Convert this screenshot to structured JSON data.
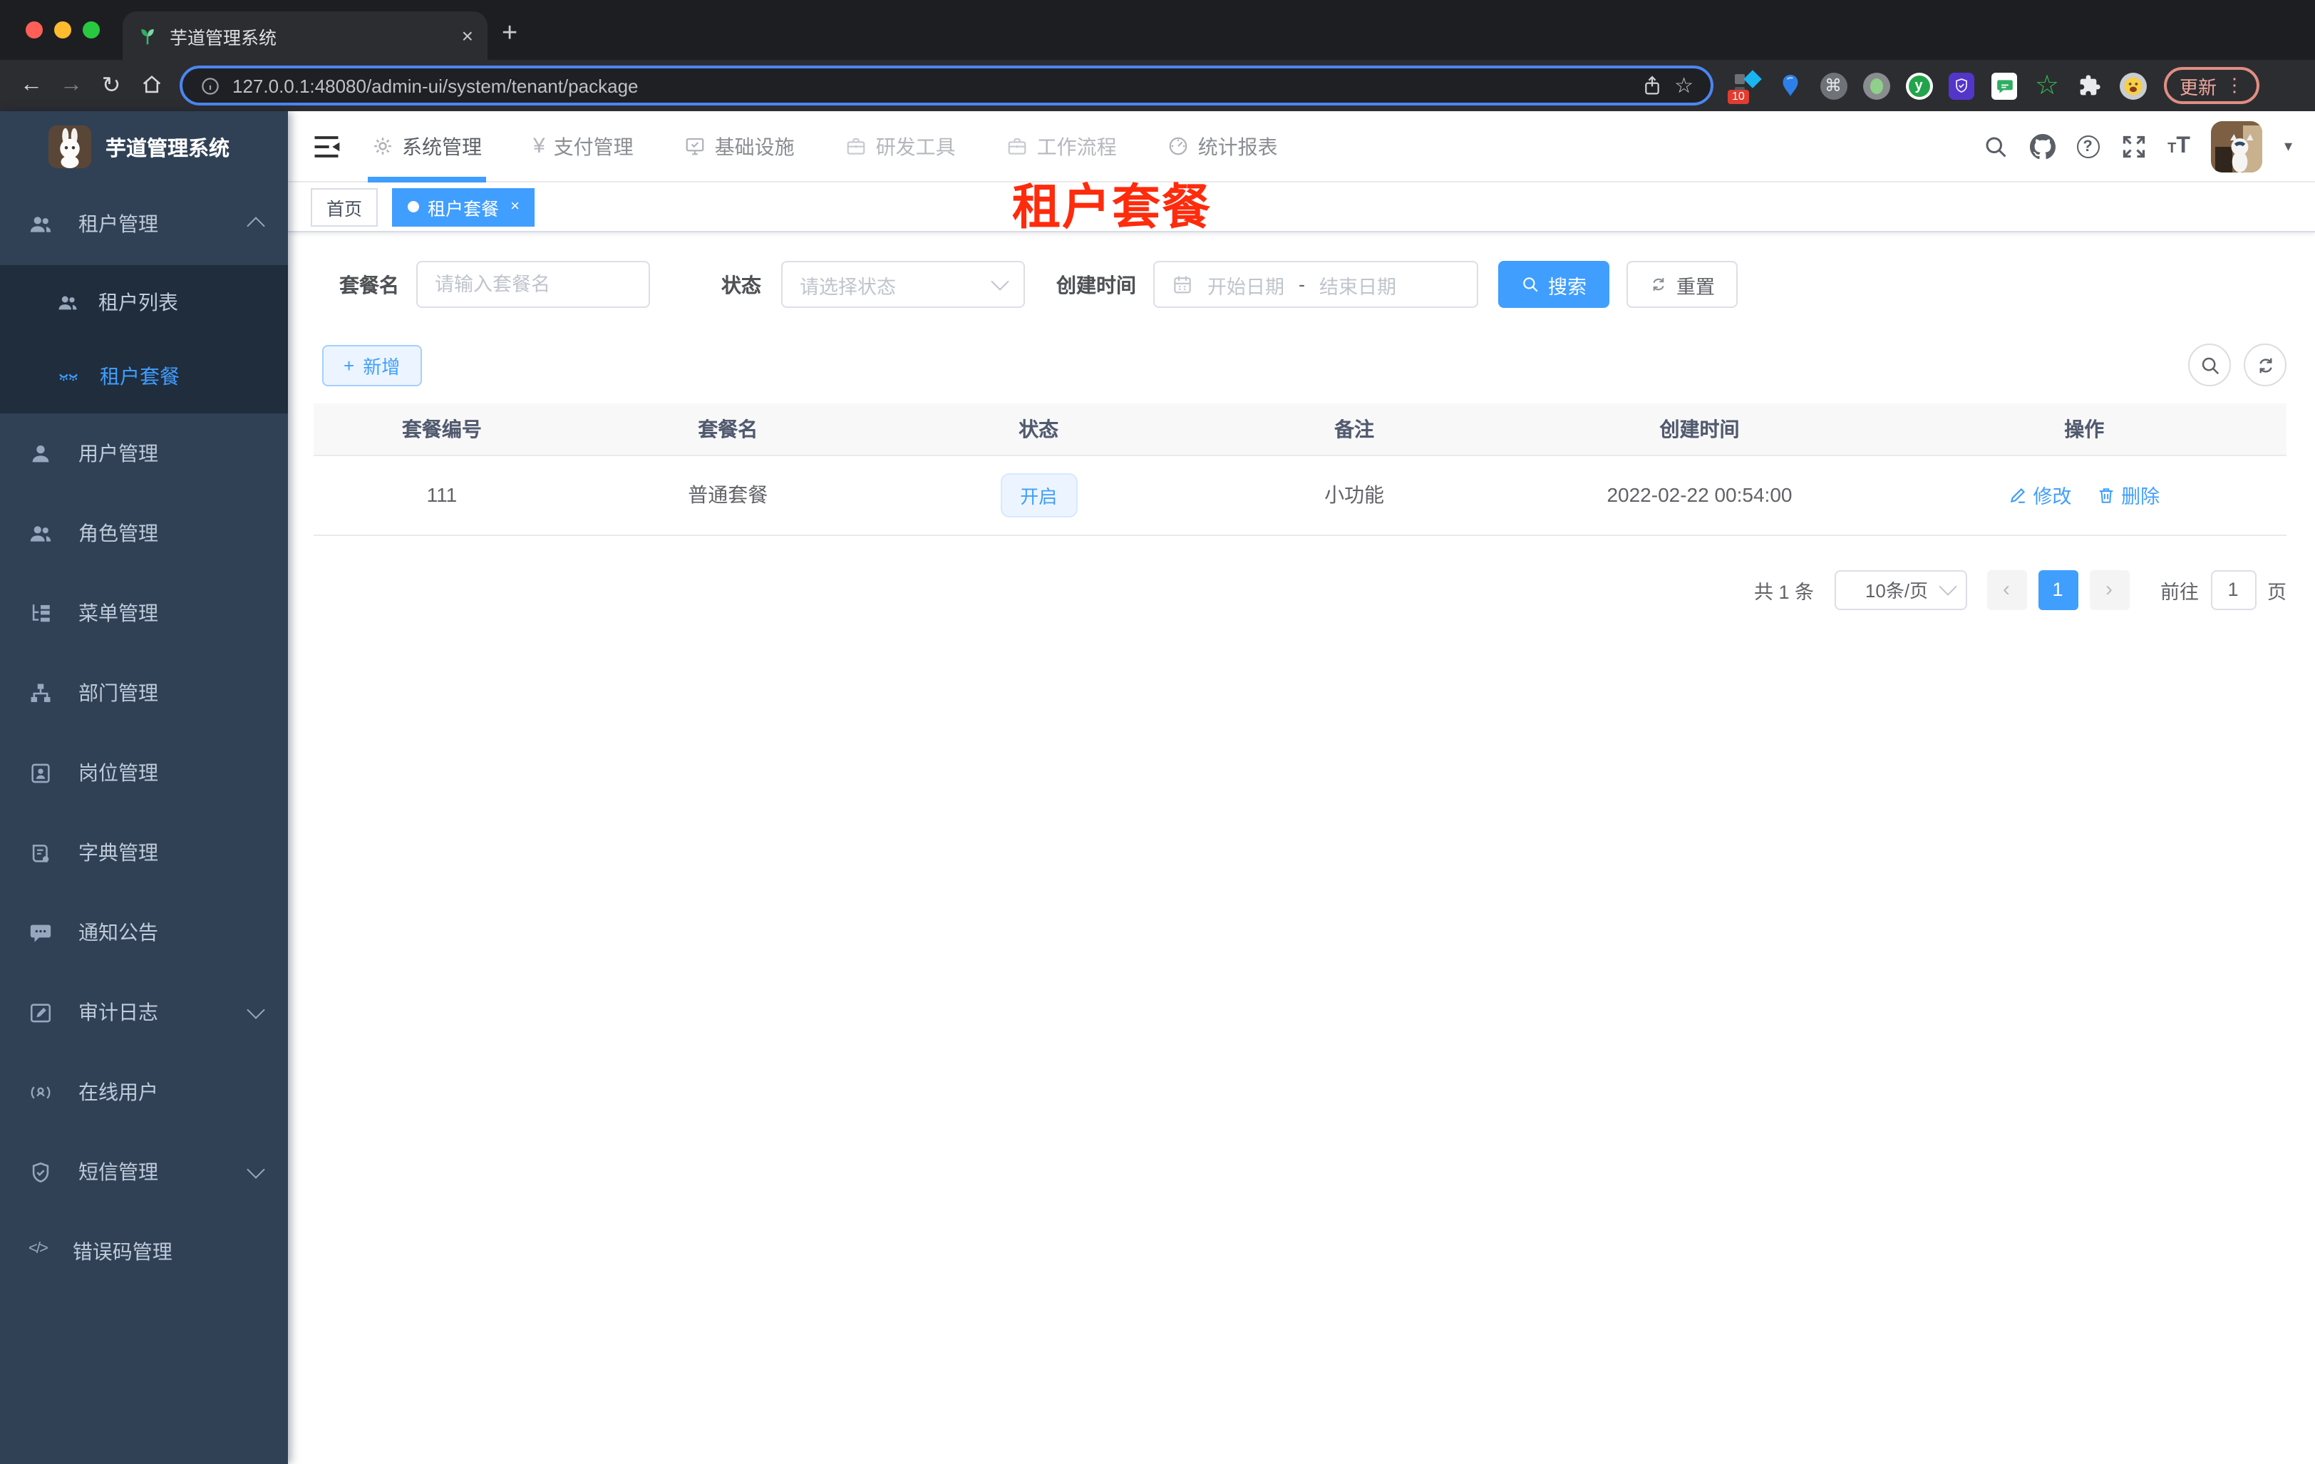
{
  "browser": {
    "tab_title": "芋道管理系统",
    "url": "127.0.0.1:48080/admin-ui/system/tenant/package",
    "update_label": "更新",
    "extensions": {
      "badge": "10",
      "y_letter": "y"
    }
  },
  "icons": {
    "back": "←",
    "forward": "→",
    "reload": "↻",
    "close": "×",
    "new_tab": "+",
    "star": "☆",
    "kebab": "⋮",
    "command": "⌘",
    "yen": "¥",
    "prev": "‹",
    "next": "›",
    "caret": "▾",
    "code": "</>",
    "font_size": "T",
    "question": "?"
  },
  "colors": {
    "accent": "#409eff",
    "annotation_red": "#fe2b0c",
    "sidebar_bg": "#304156",
    "submenu_bg": "#1f2d3d",
    "tag_bg": "#ecf5ff"
  },
  "sidebar": {
    "title": "芋道管理系统",
    "items": [
      {
        "label": "租户管理"
      },
      {
        "label": "租户列表"
      },
      {
        "label": "租户套餐"
      },
      {
        "label": "用户管理"
      },
      {
        "label": "角色管理"
      },
      {
        "label": "菜单管理"
      },
      {
        "label": "部门管理"
      },
      {
        "label": "岗位管理"
      },
      {
        "label": "字典管理"
      },
      {
        "label": "通知公告"
      },
      {
        "label": "审计日志"
      },
      {
        "label": "在线用户"
      },
      {
        "label": "短信管理"
      },
      {
        "label": "错误码管理"
      }
    ]
  },
  "topnav": {
    "items": [
      {
        "label": "系统管理"
      },
      {
        "label": "支付管理"
      },
      {
        "label": "基础设施"
      },
      {
        "label": "研发工具"
      },
      {
        "label": "工作流程"
      },
      {
        "label": "统计报表"
      }
    ]
  },
  "tags": {
    "home": "首页",
    "active": "租户套餐"
  },
  "annotation": {
    "text": "租户套餐"
  },
  "filters": {
    "name_label": "套餐名",
    "name_placeholder": "请输入套餐名",
    "status_label": "状态",
    "status_placeholder": "请选择状态",
    "date_label": "创建时间",
    "date_start": "开始日期",
    "date_sep": "-",
    "date_end": "结束日期",
    "search_label": "搜索",
    "reset_label": "重置"
  },
  "toolbar": {
    "add_label": "新增"
  },
  "table": {
    "headers": [
      "套餐编号",
      "套餐名",
      "状态",
      "备注",
      "创建时间",
      "操作"
    ],
    "rows": [
      {
        "id": "111",
        "name": "普通套餐",
        "status": "开启",
        "remark": "小功能",
        "created": "2022-02-22 00:54:00",
        "edit": "修改",
        "delete": "删除"
      }
    ]
  },
  "pagination": {
    "total": "共 1 条",
    "page_size": "10条/页",
    "page": "1",
    "goto_label": "前往",
    "goto_value": "1",
    "unit": "页"
  }
}
